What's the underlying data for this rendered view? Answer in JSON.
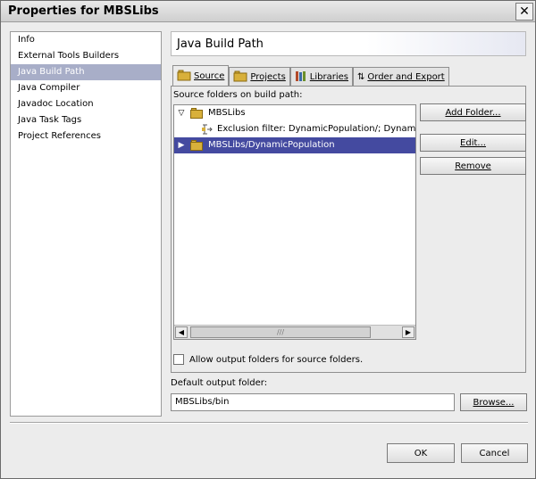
{
  "window": {
    "title": "Properties for MBSLibs"
  },
  "nav": {
    "items": [
      {
        "label": "Info"
      },
      {
        "label": "External Tools Builders"
      },
      {
        "label": "Java Build Path"
      },
      {
        "label": "Java Compiler"
      },
      {
        "label": "Javadoc Location"
      },
      {
        "label": "Java Task Tags"
      },
      {
        "label": "Project References"
      }
    ],
    "selected_index": 2
  },
  "page": {
    "title": "Java Build Path"
  },
  "tabs": [
    {
      "label": "Source"
    },
    {
      "label": "Projects"
    },
    {
      "label": "Libraries"
    },
    {
      "label": "Order and Export"
    }
  ],
  "source": {
    "label": "Source folders on build path:",
    "tree": [
      {
        "label": "MBSLibs",
        "expanded": true
      },
      {
        "label": "Exclusion filter: DynamicPopulation/; DynamicPo"
      },
      {
        "label": "MBSLibs/DynamicPopulation",
        "expanded": false,
        "selected": true
      }
    ],
    "buttons": {
      "add": "Add Folder...",
      "edit": "Edit...",
      "remove": "Remove"
    },
    "allow_label": "Allow output folders for source folders."
  },
  "output": {
    "label": "Default output folder:",
    "value": "MBSLibs/bin",
    "browse": "Browse..."
  },
  "footer": {
    "ok": "OK",
    "cancel": "Cancel"
  },
  "colors": {
    "selection_nav": "#a8aec8",
    "selection_tree": "#444aa0"
  }
}
